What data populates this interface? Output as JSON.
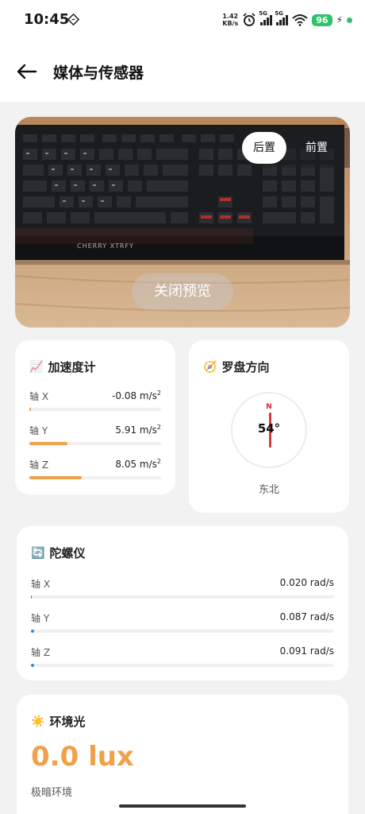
{
  "status_bar": {
    "time": "10:45",
    "net_speed_value": "1.42",
    "net_speed_unit": "KB/s",
    "signal_1": "5G",
    "signal_2": "5G",
    "battery": "96",
    "icons": [
      "nfc-icon",
      "alarm-icon",
      "signal-icon",
      "wifi-icon",
      "charging-icon"
    ]
  },
  "header": {
    "title": "媒体与传感器",
    "back_icon": "arrow-left-icon"
  },
  "camera": {
    "rear_label": "后置",
    "front_label": "前置",
    "selected": "后置",
    "close_preview_label": "关闭预览"
  },
  "accelerometer": {
    "icon": "📈",
    "title": "加速度计",
    "accent_color": "#f0a14a",
    "axes": [
      {
        "label": "轴 X",
        "value": "-0.08 m/s",
        "fill": 0.01
      },
      {
        "label": "轴 Y",
        "value": "5.91 m/s",
        "fill": 0.29
      },
      {
        "label": "轴 Z",
        "value": "8.05 m/s",
        "fill": 0.4
      }
    ],
    "unit_suffix": "2"
  },
  "compass": {
    "icon": "🧭",
    "title": "罗盘方向",
    "north_label": "N",
    "degrees": "54°",
    "direction": "东北"
  },
  "gyroscope": {
    "icon": "🔄",
    "title": "陀螺仪",
    "accent_color": "#2a8fd6",
    "axes": [
      {
        "label": "轴 X",
        "value": "0.020 rad/s",
        "fill": 0.0
      },
      {
        "label": "轴 Y",
        "value": "0.087 rad/s",
        "fill": 0.01
      },
      {
        "label": "轴 Z",
        "value": "0.091 rad/s",
        "fill": 0.01
      }
    ]
  },
  "light": {
    "icon": "☀️",
    "title": "环境光",
    "value": "0.0 lux",
    "description": "极暗环境",
    "accent_color": "#f0a14a"
  }
}
